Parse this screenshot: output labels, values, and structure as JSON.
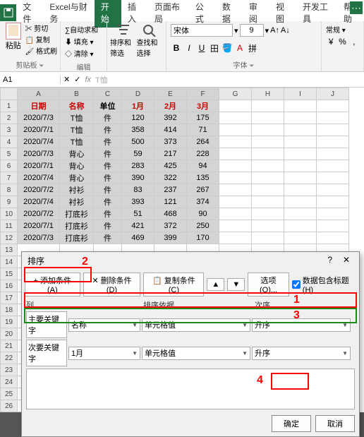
{
  "tabs": [
    "文件",
    "Excel与财务",
    "开始",
    "插入",
    "页面布局",
    "公式",
    "数据",
    "审阅",
    "视图",
    "开发工具",
    "帮助"
  ],
  "active_tab": 2,
  "ribbon": {
    "clipboard": {
      "paste": "粘贴",
      "cut": "剪切",
      "copy": "复制",
      "format": "格式刷",
      "label": "剪贴板"
    },
    "editing": {
      "sum": "∑自动求和",
      "fill": "填充",
      "clear": "清除",
      "label": "编辑"
    },
    "sort": {
      "sortfilter": "排序和筛选",
      "find": "查找和选择",
      "label": ""
    },
    "font": {
      "name": "宋体",
      "size": "9",
      "general": "常规",
      "label": "字体"
    }
  },
  "cellref": "A1",
  "formula_val": "T恤",
  "cols": [
    "A",
    "B",
    "C",
    "D",
    "E",
    "F",
    "G",
    "H",
    "I",
    "J"
  ],
  "headers": [
    "日期",
    "名称",
    "单位",
    "1月",
    "2月",
    "3月"
  ],
  "rows": [
    [
      "2020/7/3",
      "T恤",
      "件",
      "120",
      "392",
      "175"
    ],
    [
      "2020/7/1",
      "T恤",
      "件",
      "358",
      "414",
      "71"
    ],
    [
      "2020/7/4",
      "T恤",
      "件",
      "500",
      "373",
      "264"
    ],
    [
      "2020/7/3",
      "背心",
      "件",
      "59",
      "217",
      "228"
    ],
    [
      "2020/7/1",
      "背心",
      "件",
      "283",
      "425",
      "94"
    ],
    [
      "2020/7/4",
      "背心",
      "件",
      "390",
      "322",
      "135"
    ],
    [
      "2020/7/2",
      "衬衫",
      "件",
      "83",
      "237",
      "267"
    ],
    [
      "2020/7/4",
      "衬衫",
      "件",
      "393",
      "121",
      "374"
    ],
    [
      "2020/7/2",
      "打底衫",
      "件",
      "51",
      "468",
      "90"
    ],
    [
      "2020/7/1",
      "打底衫",
      "件",
      "421",
      "372",
      "250"
    ],
    [
      "2020/7/3",
      "打底衫",
      "件",
      "469",
      "399",
      "170"
    ]
  ],
  "dialog": {
    "title": "排序",
    "add": "添加条件(A)",
    "del": "删除条件(D)",
    "copy": "复制条件(C)",
    "options": "选项(O)...",
    "has_header": "数据包含标题(H)",
    "col_hdr": "列",
    "basis_hdr": "排序依据",
    "order_hdr": "次序",
    "primary": "主要关键字",
    "secondary": "次要关键字",
    "r1_col": "名称",
    "r1_basis": "单元格值",
    "r1_order": "升序",
    "r2_col": "1月",
    "r2_basis": "单元格值",
    "r2_order": "升序",
    "ok": "确定",
    "cancel": "取消"
  },
  "anno": {
    "n1": "1",
    "n2": "2",
    "n3": "3",
    "n4": "4"
  }
}
